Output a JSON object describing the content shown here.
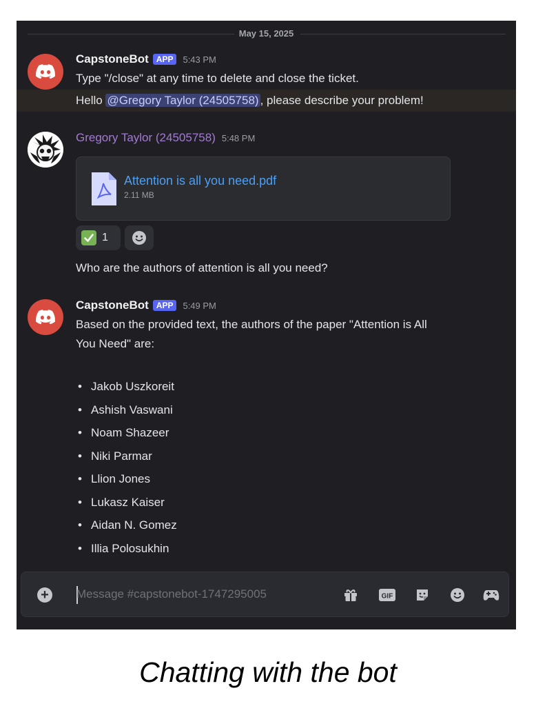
{
  "divider": {
    "date": "May 15, 2025"
  },
  "messages": {
    "bot1": {
      "author": "CapstoneBot",
      "badge": "APP",
      "time": "5:43 PM",
      "line1": "Type \"/close\" at any time to delete and close the ticket.",
      "line2_prefix": "Hello ",
      "line2_mention": "@Gregory Taylor (24505758)",
      "line2_suffix": ", please describe your problem!"
    },
    "user1": {
      "author": "Gregory Taylor (24505758)",
      "time": "5:48 PM",
      "attachment": {
        "name": "Attention is all you need.pdf",
        "size": "2.11 MB"
      },
      "reactions": [
        {
          "emoji": "white-check-mark",
          "count": "1"
        }
      ],
      "text": "Who are the authors of attention is all you need?"
    },
    "bot2": {
      "author": "CapstoneBot",
      "badge": "APP",
      "time": "5:49 PM",
      "line1": "Based on the provided text, the authors of the paper \"Attention is All",
      "line2": "You Need\" are:",
      "authors": [
        "Jakob Uszkoreit",
        "Ashish Vaswani",
        "Noam Shazeer",
        "Niki Parmar",
        "Llion Jones",
        "Lukasz Kaiser",
        "Aidan N. Gomez",
        "Illia Polosukhin"
      ]
    }
  },
  "composer": {
    "placeholder": "Message #capstonebot-1747295005",
    "gif_label": "GIF",
    "icons": [
      "add-circle-icon",
      "gift-icon",
      "gif-icon",
      "sticker-icon",
      "emoji-icon",
      "activities-icon"
    ]
  },
  "caption": "Chatting with the bot",
  "colors": {
    "background": "#1f1f23",
    "blurple": "#5865f2",
    "bot_avatar": "#d94a3f",
    "user_name": "#a37ad4",
    "link": "#4c9ff2",
    "mention_bg": "#3c4274"
  }
}
